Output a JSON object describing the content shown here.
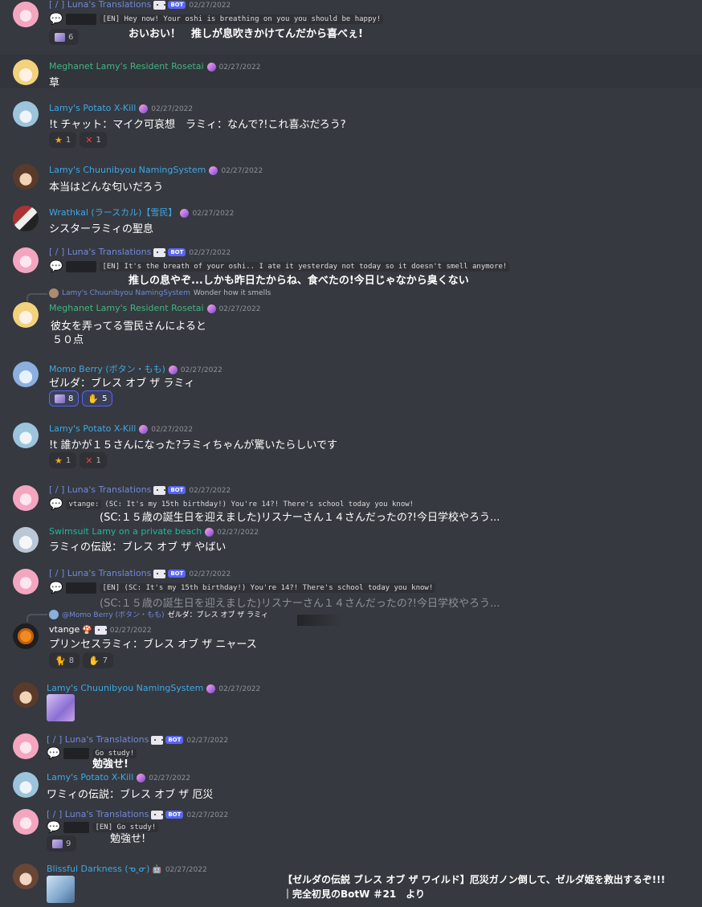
{
  "messages": {
    "m1": {
      "name": "[ / ] Luna's Translations",
      "bot": "BOT",
      "ts": "02/27/2022",
      "en": "[EN] Hey now! Your oshi is breathing on you you should be happy!",
      "jp": "おいおい！　推しが息吹きかけてんだから喜べぇ!",
      "reactions": [
        {
          "icon": "lamy-emote",
          "count": "6"
        }
      ]
    },
    "m2": {
      "name": "Meghanet Lamy's Resident Rosetai",
      "ts": "02/27/2022",
      "text": "草"
    },
    "m3": {
      "name": "Lamy's Potato X-Kill",
      "ts": "02/27/2022",
      "text": "!t チャット：マイク可哀想　ラミィ：なんで?!これ喜ぶだろう?",
      "reactions": [
        {
          "icon": "star",
          "count": "1"
        },
        {
          "icon": "cross",
          "count": "1"
        }
      ]
    },
    "m4": {
      "name": "Lamy's Chuunibyou NamingSystem",
      "ts": "02/27/2022",
      "text": "本当はどんな匂いだろう"
    },
    "m5": {
      "name": "Wrathkal (ラースカル)【雪民】",
      "ts": "02/27/2022",
      "text": "シスターラミィの聖息"
    },
    "m6": {
      "name": "[ / ] Luna's Translations",
      "bot": "BOT",
      "ts": "02/27/2022",
      "en": "[EN] It's the breath of your oshi.. I ate it yesterday not today so it doesn't smell anymore!",
      "jp": "推しの息やぞ...しかも昨日たからね、食べたの!今日じゃなから臭くない"
    },
    "m7": {
      "reply_name": "Lamy's Chuunibyou NamingSystem",
      "reply_text": "Wonder how it smells",
      "name": "Meghanet Lamy's Resident Rosetai",
      "ts": "02/27/2022",
      "line1": "彼女を弄ってる雪民さんによると",
      "line2": "５０点"
    },
    "m8": {
      "name": "Momo Berry (ボタン・もも)",
      "ts": "02/27/2022",
      "text": "ゼルダ：ブレス オブ ザ ラミィ",
      "reactions": [
        {
          "icon": "lamy-emote",
          "count": "8"
        },
        {
          "icon": "hand-emote",
          "count": "5"
        }
      ]
    },
    "m9": {
      "name": "Lamy's Potato X-Kill",
      "ts": "02/27/2022",
      "text": "!t 誰かが１５さんになった?ラミィちゃんが驚いたらしいです",
      "reactions": [
        {
          "icon": "star",
          "count": "1"
        },
        {
          "icon": "cross",
          "count": "1"
        }
      ]
    },
    "m10": {
      "name": "[ / ] Luna's Translations",
      "bot": "BOT",
      "ts": "02/27/2022",
      "user": "vtange:",
      "en": "(SC: It's my 15th birthday!) You're 14?! There's school today you know!",
      "jp": "(SC:１５歳の誕生日を迎えました)リスナーさん１４さんだったの?!今日学校やろう..."
    },
    "m11": {
      "name": "Swimsuit Lamy on a private beach",
      "ts": "02/27/2022",
      "text": "ラミィの伝説：ブレス オブ ザ やばい"
    },
    "m12": {
      "name": "[ / ] Luna's Translations",
      "bot": "BOT",
      "ts": "02/27/2022",
      "en": "[EN] (SC: It's my 15th birthday!) You're 14?! There's school today you know!",
      "jp": "(SC:１５歳の誕生日を迎えました)リスナーさん１４さんだったの?!今日学校やろう..."
    },
    "m13": {
      "reply_name": "@Momo Berry (ボタン・もも)",
      "reply_text": "ゼルダ：ブレス オブ ザ ラミィ",
      "name": "vtange",
      "ts": "02/27/2022",
      "text": "プリンセスラミィ：ブレス オブ ザ ニャース",
      "reactions": [
        {
          "icon": "cat-emote",
          "count": "8"
        },
        {
          "icon": "hand-emote",
          "count": "7"
        }
      ]
    },
    "m14": {
      "name": "Lamy's Chuunibyou NamingSystem",
      "ts": "02/27/2022"
    },
    "m15": {
      "name": "[ / ] Luna's Translations",
      "bot": "BOT",
      "ts": "02/27/2022",
      "en": "Go study!",
      "jp": "勉強せ!"
    },
    "m16": {
      "name": "Lamy's Potato X-Kill",
      "ts": "02/27/2022",
      "text": "ワミィの伝説：ブレス オブ ザ 厄災"
    },
    "m17": {
      "name": "[ / ] Luna's Translations",
      "bot": "BOT",
      "ts": "02/27/2022",
      "en": "[EN] Go study!",
      "jp": "勉強せ!",
      "reactions": [
        {
          "icon": "lamy-emote",
          "count": "9"
        }
      ]
    },
    "m18": {
      "name": "Blissful Darkness (ᓀ‸ᓂ)",
      "ts": "02/27/2022"
    }
  },
  "stream_caption": {
    "line1": "【ゼルダの伝説 ブレス オブ ザ ワイルド】厄災ガノン倒して、ゼルダ姫を救出するぞ!!!",
    "line2": "｜完全初見のBotW ＃21　より"
  },
  "colors": {
    "background": "#36393f",
    "bot_badge": "#5865f2",
    "luna_name": "#7289da",
    "green_name": "#43b581",
    "blue_name": "#3ea8e5"
  }
}
